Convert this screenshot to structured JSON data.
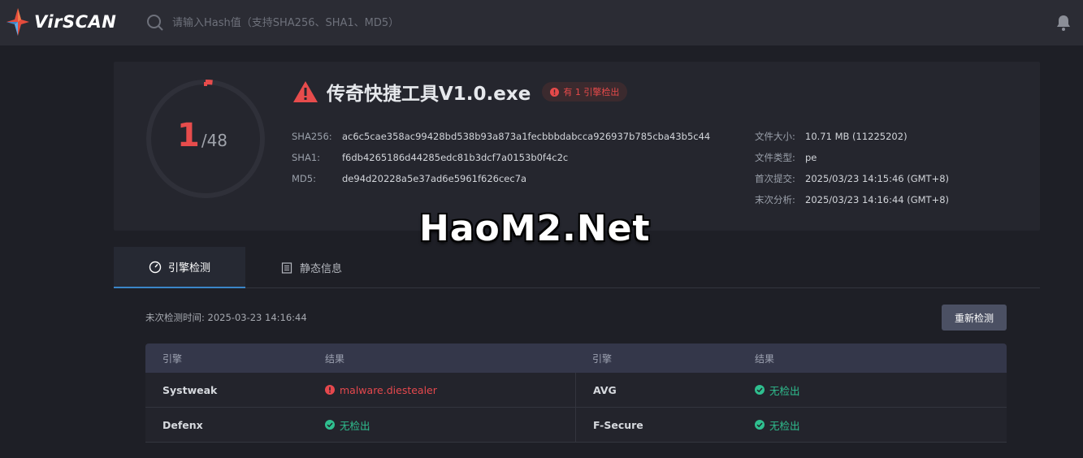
{
  "header": {
    "logo_text": "VirSCAN",
    "search_placeholder": "请输入Hash值（支持SHA256、SHA1、MD5）",
    "icons": [
      "logo-icon",
      "search-icon",
      "bell-icon"
    ]
  },
  "summary": {
    "detections": "1",
    "total": "/48",
    "file_name": "传奇快捷工具V1.0.exe",
    "badge": "有 1 引擎检出",
    "hashes": [
      {
        "label": "SHA256:",
        "value": "ac6c5cae358ac99428bd538b93a873a1fecbbbdabcca926937b785cba43b5c44"
      },
      {
        "label": "SHA1:",
        "value": "f6db4265186d44285edc81b3dcf7a0153b0f4c2c"
      },
      {
        "label": "MD5:",
        "value": "de94d20228a5e37ad6e5961f626cec7a"
      }
    ],
    "meta": [
      {
        "label": "文件大小:",
        "value": "10.71 MB (11225202)"
      },
      {
        "label": "文件类型:",
        "value": "pe"
      },
      {
        "label": "首次提交:",
        "value": "2025/03/23 14:15:46 (GMT+8)"
      },
      {
        "label": "末次分析:",
        "value": "2025/03/23 14:16:44 (GMT+8)"
      }
    ],
    "colors": {
      "danger": "#e74c4c",
      "ok": "#2fbf8f",
      "accent": "#3a86c8"
    }
  },
  "watermark": "HaoM2.Net",
  "tabs": [
    {
      "label": "引擎检测",
      "icon": "gauge-icon",
      "active": true
    },
    {
      "label": "静态信息",
      "icon": "document-icon",
      "active": false
    }
  ],
  "scan": {
    "time": "未次检测时间: 2025-03-23 14:16:44",
    "rescan_label": "重新检测"
  },
  "table": {
    "headers": [
      "引擎",
      "结果",
      "引擎",
      "结果"
    ],
    "rows": [
      {
        "engine1": "Systweak",
        "result1": "malware.diestealer",
        "status1": "bad",
        "engine2": "AVG",
        "result2": "无检出",
        "status2": "ok"
      },
      {
        "engine1": "Defenx",
        "result1": "无检出",
        "status1": "ok",
        "engine2": "F-Secure",
        "result2": "无检出",
        "status2": "ok"
      }
    ]
  }
}
